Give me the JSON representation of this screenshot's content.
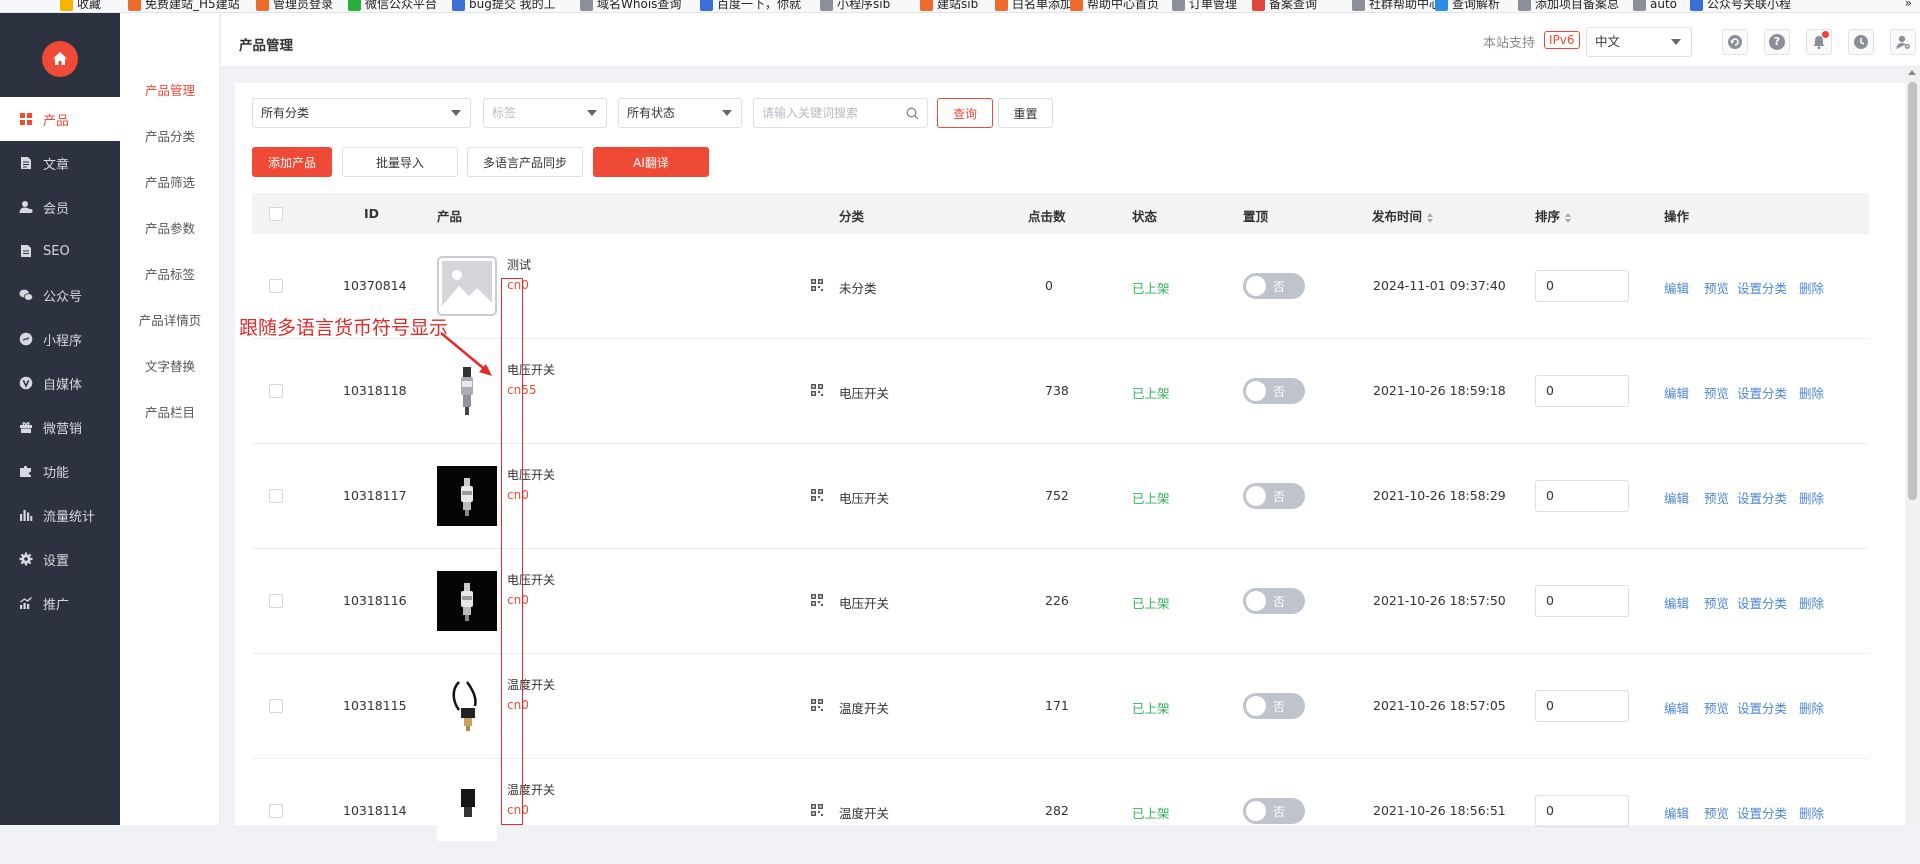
{
  "bookmarks": [
    "收藏",
    "免费建站_H5建站",
    "管理员登录",
    "微信公众平台",
    "bug提交 我的工",
    "域名Whois查询",
    "百度一下，你就",
    "小程序sib",
    "建站sib",
    "白名单添加",
    "帮助中心首页",
    "订单管理",
    "备案查询",
    "社群帮助中心",
    "查询解析",
    "添加项目备案总",
    "auto",
    "公众号关联小程"
  ],
  "nav": {
    "items": [
      {
        "label": "产品",
        "icon": "grid-icon"
      },
      {
        "label": "文章",
        "icon": "document-icon"
      },
      {
        "label": "会员",
        "icon": "user-icon"
      },
      {
        "label": "SEO",
        "icon": "seo-icon"
      },
      {
        "label": "公众号",
        "icon": "wechat-icon"
      },
      {
        "label": "小程序",
        "icon": "miniprogram-icon"
      },
      {
        "label": "自媒体",
        "icon": "v-icon"
      },
      {
        "label": "微营销",
        "icon": "gift-icon"
      },
      {
        "label": "功能",
        "icon": "puzzle-icon"
      },
      {
        "label": "流量统计",
        "icon": "bar-chart-icon"
      },
      {
        "label": "设置",
        "icon": "gear-icon"
      },
      {
        "label": "推广",
        "icon": "trend-icon"
      }
    ],
    "active_index": 0
  },
  "submenu": {
    "items": [
      "产品管理",
      "产品分类",
      "产品筛选",
      "产品参数",
      "产品标签",
      "产品详情页",
      "文字替换",
      "产品栏目"
    ],
    "active_index": 0
  },
  "header": {
    "title": "产品管理",
    "support_label": "本站支持",
    "ipv6_badge": "IPv6",
    "language": "中文",
    "icons": [
      "refresh-icon",
      "help-icon",
      "bell-icon",
      "clock-icon",
      "user-settings-icon"
    ],
    "colors": {
      "accent": "#ef4a35",
      "sidebar": "#2d3241"
    }
  },
  "filters": {
    "category": "所有分类",
    "tag_placeholder": "标签",
    "status": "所有状态",
    "search_placeholder": "请输入关键词搜索",
    "query_button": "查询",
    "reset_button": "重置"
  },
  "actions": {
    "add": "添加产品",
    "import": "批量导入",
    "sync": "多语言产品同步",
    "translate": "AI翻译"
  },
  "table": {
    "columns": {
      "id": "ID",
      "product": "产品",
      "category": "分类",
      "clicks": "点击数",
      "status": "状态",
      "top": "置顶",
      "publish_time": "发布时间",
      "sort": "排序",
      "ops": "操作"
    },
    "rows": [
      {
        "id": "10370814",
        "name": "测试",
        "price": "cn0",
        "category": "未分类",
        "clicks": "0",
        "status": "已上架",
        "top": "否",
        "time": "2024-11-01 09:37:40",
        "sort": "0",
        "image": "placeholder-image"
      },
      {
        "id": "10318118",
        "name": "电压开关",
        "price": "cn55",
        "category": "电压开关",
        "clicks": "738",
        "status": "已上架",
        "top": "否",
        "time": "2021-10-26 18:59:18",
        "sort": "0",
        "image": "sensor-white-bg"
      },
      {
        "id": "10318117",
        "name": "电压开关",
        "price": "cn0",
        "category": "电压开关",
        "clicks": "752",
        "status": "已上架",
        "top": "否",
        "time": "2021-10-26 18:58:29",
        "sort": "0",
        "image": "sensor-black-bg"
      },
      {
        "id": "10318116",
        "name": "电压开关",
        "price": "cn0",
        "category": "电压开关",
        "clicks": "226",
        "status": "已上架",
        "top": "否",
        "time": "2021-10-26 18:57:50",
        "sort": "0",
        "image": "sensor-black-bg"
      },
      {
        "id": "10318115",
        "name": "温度开关",
        "price": "cn0",
        "category": "温度开关",
        "clicks": "171",
        "status": "已上架",
        "top": "否",
        "time": "2021-10-26 18:57:05",
        "sort": "0",
        "image": "thermo-switch"
      },
      {
        "id": "10318114",
        "name": "温度开关",
        "price": "cn0",
        "category": "温度开关",
        "clicks": "282",
        "status": "已上架",
        "top": "否",
        "time": "2021-10-26 18:56:51",
        "sort": "0",
        "image": "thermo-switch-2"
      }
    ],
    "row_actions": [
      "编辑",
      "预览",
      "设置分类",
      "删除"
    ]
  },
  "annotation": {
    "text": "跟随多语言货币符号显示"
  }
}
